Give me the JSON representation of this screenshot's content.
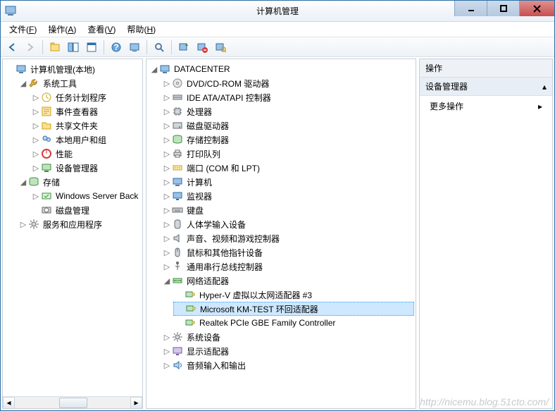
{
  "window": {
    "title": "计算机管理"
  },
  "menubar": [
    {
      "label": "文件",
      "key": "F"
    },
    {
      "label": "操作",
      "key": "A"
    },
    {
      "label": "查看",
      "key": "V"
    },
    {
      "label": "帮助",
      "key": "H"
    }
  ],
  "toolbar": {
    "back": "后退",
    "forward": "前进",
    "up": "上移",
    "properties": "属性",
    "views": "视图",
    "help": "帮助",
    "console": "控制台",
    "find": "查找",
    "refresh": "刷新",
    "uninstall": "卸载",
    "scan": "扫描硬件更改"
  },
  "leftTree": {
    "root": "计算机管理(本地)",
    "systemTools": "系统工具",
    "systemToolsChildren": [
      "任务计划程序",
      "事件查看器",
      "共享文件夹",
      "本地用户和组",
      "性能",
      "设备管理器"
    ],
    "storage": "存储",
    "storageChildren": [
      "Windows Server Back",
      "磁盘管理"
    ],
    "services": "服务和应用程序"
  },
  "midTree": {
    "root": "DATACENTER",
    "categories": [
      "DVD/CD-ROM 驱动器",
      "IDE ATA/ATAPI 控制器",
      "处理器",
      "磁盘驱动器",
      "存储控制器",
      "打印队列",
      "端口 (COM 和 LPT)",
      "计算机",
      "监视器",
      "键盘",
      "人体学输入设备",
      "声音、视频和游戏控制器",
      "鼠标和其他指针设备",
      "通用串行总线控制器"
    ],
    "network": "网络适配器",
    "networkChildren": [
      "Hyper-V 虚拟以太网适配器 #3",
      "Microsoft KM-TEST 环回适配器",
      "Realtek PCIe GBE Family Controller"
    ],
    "afterNetwork": [
      "系统设备",
      "显示适配器",
      "音频输入和输出"
    ],
    "selectedIndex": 1
  },
  "actions": {
    "header": "操作",
    "subtitle": "设备管理器",
    "item": "更多操作"
  },
  "watermark": "http://nicemu.blog.51cto.com/"
}
